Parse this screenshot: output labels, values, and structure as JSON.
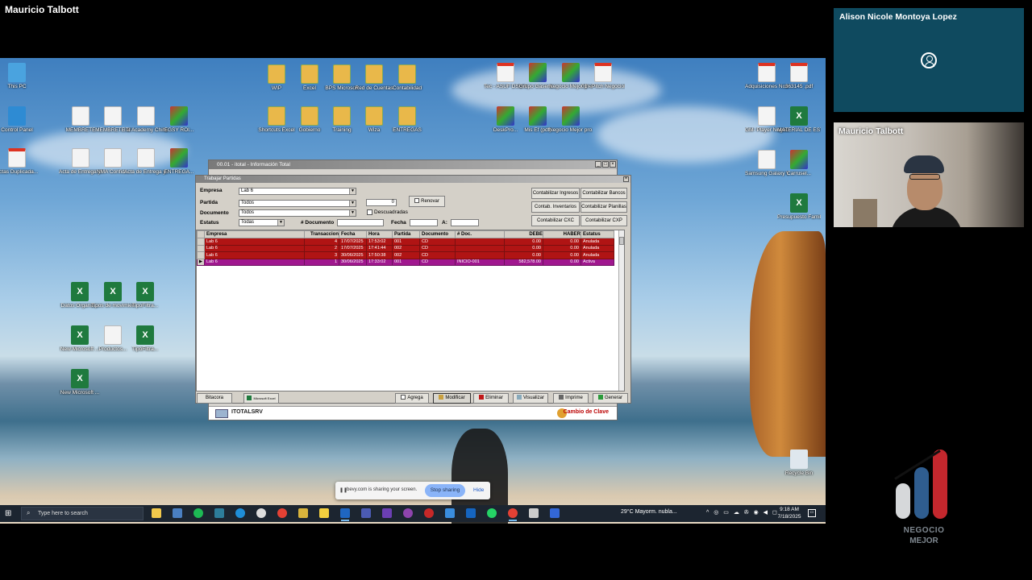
{
  "presenter": {
    "name": "Mauricio Talbott"
  },
  "desktop": {
    "icons": [
      {
        "label": "This PC",
        "kind": "pc"
      },
      {
        "label": "Control Panel",
        "kind": "cp"
      },
      {
        "label": "Actas Duplicada...",
        "kind": "pdf"
      },
      {
        "label": "MEMBRETE",
        "kind": "doc"
      },
      {
        "label": "MEMBRETE al",
        "kind": "doc"
      },
      {
        "label": "ITI Academy Chihuahua",
        "kind": "doc"
      },
      {
        "label": "EGSY ROI...",
        "kind": "img"
      },
      {
        "label": "Acta de Entrega y R...",
        "kind": "doc"
      },
      {
        "label": "NMA Confid...",
        "kind": "doc"
      },
      {
        "label": "Acta de Entrega y R...",
        "kind": "doc"
      },
      {
        "label": "ENTREGA...",
        "kind": "img"
      },
      {
        "label": "WIP",
        "kind": "zip"
      },
      {
        "label": "Excel",
        "kind": "zip"
      },
      {
        "label": "BPS Microsoft",
        "kind": "zip"
      },
      {
        "label": "Red de Cuentas",
        "kind": "zip"
      },
      {
        "label": "Contabilidad",
        "kind": "zip"
      },
      {
        "label": "Shortcuts Excel",
        "kind": "zip"
      },
      {
        "label": "Gobierno",
        "kind": "zip"
      },
      {
        "label": "Training",
        "kind": "zip"
      },
      {
        "label": "Wiza",
        "kind": "zip"
      },
      {
        "label": "ENTREGAS",
        "kind": "zip"
      },
      {
        "label": "Datos Organiz...",
        "kind": "xls"
      },
      {
        "label": "Tipos de movimiento...",
        "kind": "xls"
      },
      {
        "label": "TipoFiltra...",
        "kind": "xls"
      },
      {
        "label": "New Microsoft ...",
        "kind": "xls"
      },
      {
        "label": "Productos...",
        "kind": "doc"
      },
      {
        "label": "TipoFiltra...",
        "kind": "xls"
      },
      {
        "label": "New Microsoft ...",
        "kind": "xls"
      },
      {
        "label": "Tec - ASUF DSU Forma...",
        "kind": "pdf"
      },
      {
        "label": "Grupo Gasera...",
        "kind": "img"
      },
      {
        "label": "Negocio Mejor (frec...",
        "kind": "img"
      },
      {
        "label": "01 - Pitch NegocioM...",
        "kind": "pdf"
      },
      {
        "label": "DeskPro...",
        "kind": "img"
      },
      {
        "label": "Mis Ef (pdf)",
        "kind": "img"
      },
      {
        "label": "Negocio Mejor pro...",
        "kind": "img"
      },
      {
        "label": "Adquisiciones Nosotros.pdf",
        "kind": "pdf"
      },
      {
        "label": "363145 .pdf",
        "kind": "pdf"
      },
      {
        "label": "GM- Player Negocio...",
        "kind": "doc"
      },
      {
        "label": "MATERIAL DE ESTUDIO...",
        "kind": "xls"
      },
      {
        "label": "Samsung Galaxy Whats...",
        "kind": "doc"
      },
      {
        "label": "Carrusel...",
        "kind": "img"
      },
      {
        "label": "Presupuesto Familia Q...",
        "kind": "xls"
      },
      {
        "label": "Recycle Bin",
        "kind": "bin"
      }
    ]
  },
  "app": {
    "outer_title": "00.01 - itotal - Información Total",
    "dialog_title": "Trabajar Partidas",
    "filters": {
      "empresa_label": "Empresa",
      "empresa_value": "Lab 6",
      "partida_label": "Partida",
      "partida_value": "Todos",
      "documento_label": "Documento",
      "documento_value": "Todos",
      "estatus_label": "Estatus",
      "estatus_value": "Todas",
      "counter_value": "0",
      "renovar_label": "Renovar",
      "descuadradas_label": "Descuadradas",
      "num_documento_label": "# Documento",
      "fecha_label": "Fecha",
      "a_label": "A:"
    },
    "side_buttons": {
      "contabilizar_ingresos": "Contabilizar Ingresos",
      "contabilizar_bancos": "Contabilizar Bancos",
      "contab_inventarios": "Contab. Inventarios",
      "contabilizar_planillas": "Contabilizar Planillas",
      "contabilizar_cxc": "Contabilizar CXC",
      "contabilizar_cxp": "Contabilizar CXP"
    },
    "table": {
      "columns": [
        "Empresa",
        "Transaccion",
        "Fecha",
        "Hora",
        "Partida",
        "Documento",
        "# Doc.",
        "DEBE",
        "HABER",
        "Estatus"
      ],
      "rows": [
        {
          "empresa": "Lab 6",
          "transaccion": "4",
          "fecha": "17/07/2025",
          "hora": "17:53:02",
          "partida": "001",
          "documento": "CD",
          "doc": "",
          "debe": "0.00",
          "haber": "0.00",
          "estatus": "Anulada",
          "state": "anul"
        },
        {
          "empresa": "Lab 6",
          "transaccion": "2",
          "fecha": "17/07/2025",
          "hora": "17:41:44",
          "partida": "002",
          "documento": "CD",
          "doc": "",
          "debe": "0.00",
          "haber": "0.00",
          "estatus": "Anulada",
          "state": "anul"
        },
        {
          "empresa": "Lab 6",
          "transaccion": "3",
          "fecha": "30/06/2025",
          "hora": "17:50:38",
          "partida": "002",
          "documento": "CD",
          "doc": "",
          "debe": "0.00",
          "haber": "0.00",
          "estatus": "Anulada",
          "state": "anul"
        },
        {
          "empresa": "Lab 6",
          "transaccion": "1",
          "fecha": "30/06/2025",
          "hora": "17:33:02",
          "partida": "001",
          "documento": "CD",
          "doc": "INICIO-001",
          "debe": "582,578.00",
          "haber": "0.00",
          "estatus": "Activa",
          "state": "act"
        }
      ]
    },
    "bottom_buttons": {
      "bitacora": "Bitacora",
      "excel": "Microsoft Excel",
      "agrega": "Agrega",
      "modificar": "Modificar",
      "eliminar": "Eliminar",
      "visualizar": "Visualizar",
      "imprime": "Imprime",
      "generar": "Generar"
    },
    "status": {
      "server": "ITOTALSRV",
      "cambio_clave": "Cambio de Clave"
    }
  },
  "sharebar": {
    "message": "bevy.com is sharing your screen.",
    "stop_label": "Stop sharing",
    "hide_label": "Hide"
  },
  "taskbar": {
    "search_placeholder": "Type here to search",
    "weather": "29°C  Mayorm. nubla...",
    "time": "9:18 AM",
    "date": "7/18/2025"
  },
  "participants": [
    {
      "name": "Alison Nicole Montoya Lopez",
      "video": false
    },
    {
      "name": "Mauricio Talbott",
      "video": true
    }
  ],
  "logo": {
    "line1": "NEGOCIO",
    "line2": "MEJOR"
  },
  "colors": {
    "anulada_row": "#b01414",
    "activa_row": "#a0178f",
    "tile_bg": "#0f4a5f",
    "stop_sharing": "#8ab4f8"
  }
}
